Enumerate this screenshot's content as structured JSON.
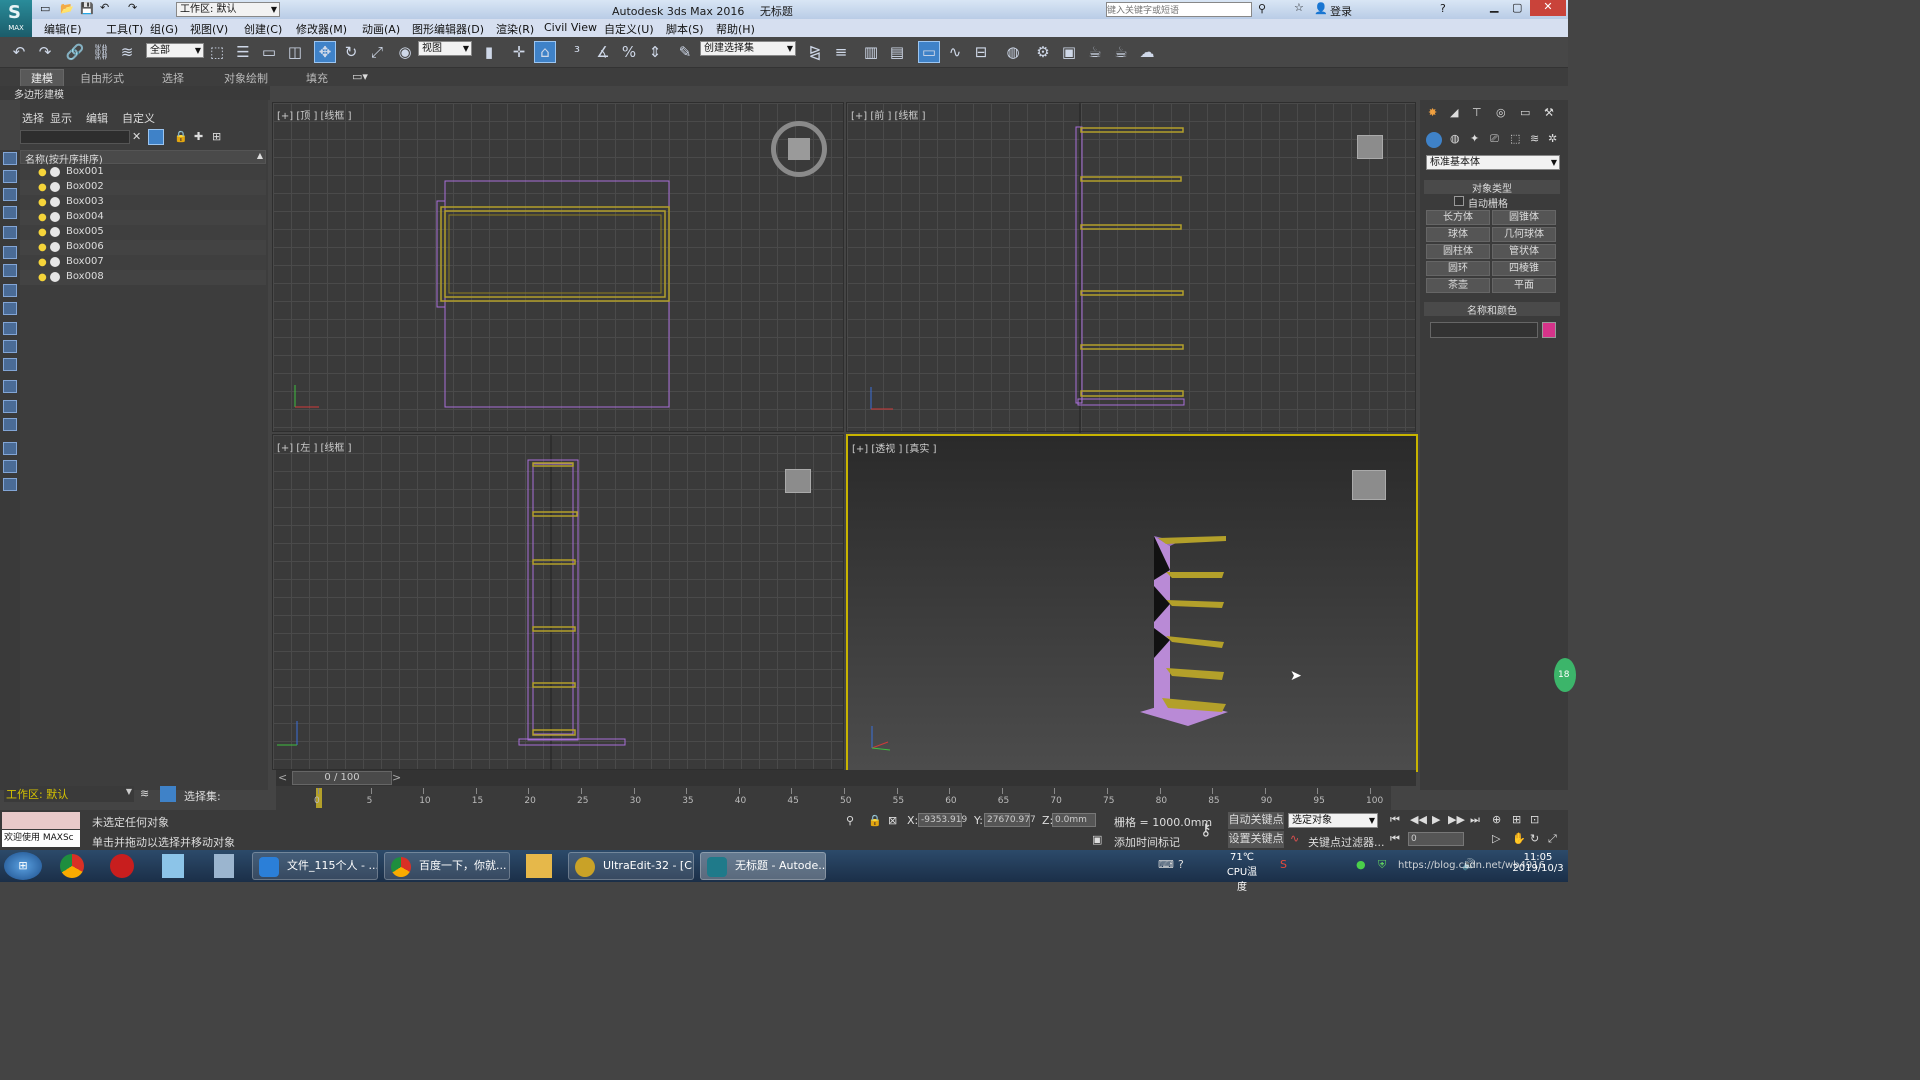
{
  "title_bar": {
    "workspace_label": "工作区: 默认",
    "app_title": "Autodesk 3ds Max 2016",
    "doc_title": "无标题",
    "search_placeholder": "键入关键字或短语",
    "login_label": "登录",
    "logo_text": "MAX"
  },
  "menu": [
    "编辑(E)",
    "工具(T)",
    "组(G)",
    "视图(V)",
    "创建(C)",
    "修改器(M)",
    "动画(A)",
    "图形编辑器(D)",
    "渲染(R)",
    "Civil View",
    "自定义(U)",
    "脚本(S)",
    "帮助(H)"
  ],
  "toolbar": {
    "selection_filter": "全部",
    "ref_coord": "视图",
    "named_selection": "创建选择集"
  },
  "ribbon": {
    "tabs": [
      "建模",
      "自由形式",
      "选择",
      "对象绘制",
      "填充"
    ],
    "active_tab": "建模",
    "sub_label": "多边形建模"
  },
  "scene_explorer": {
    "menu": [
      "选择",
      "显示",
      "编辑",
      "自定义"
    ],
    "column_header": "名称(按升序排序)",
    "items": [
      "Box001",
      "Box002",
      "Box003",
      "Box004",
      "Box005",
      "Box006",
      "Box007",
      "Box008"
    ],
    "workspace": "工作区: 默认",
    "selection_set_label": "选择集:"
  },
  "viewports": {
    "top": "[+] [顶 ] [线框 ]",
    "front": "[+] [前 ] [线框 ]",
    "left": "[+] [左 ] [线框 ]",
    "perspective": "[+] [透视 ] [真实 ]"
  },
  "command_panel": {
    "category": "标准基本体",
    "rollout_object_type": "对象类型",
    "autogrid": "自动栅格",
    "buttons": [
      "长方体",
      "圆锥体",
      "球体",
      "几何球体",
      "圆柱体",
      "管状体",
      "圆环",
      "四棱锥",
      "茶壶",
      "平面"
    ],
    "rollout_name_color": "名称和颜色",
    "object_color": "#d6338a"
  },
  "timeline": {
    "frame_label": "0 / 100",
    "ticks": [
      "0",
      "5",
      "10",
      "15",
      "20",
      "25",
      "30",
      "35",
      "40",
      "45",
      "50",
      "55",
      "60",
      "65",
      "70",
      "75",
      "80",
      "85",
      "90",
      "95",
      "100"
    ]
  },
  "status": {
    "welcome": "欢迎使用 MAXSc",
    "selection_msg": "未选定任何对象",
    "prompt": "单击并拖动以选择并移动对象",
    "x_label": "X:",
    "x_value": "-9353.919",
    "y_label": "Y:",
    "y_value": "27670.977",
    "z_label": "Z:",
    "z_value": "0.0mm",
    "grid": "栅格 = 1000.0mm",
    "auto_key": "自动关键点",
    "set_key": "设置关键点",
    "key_mode": "选定对象",
    "key_filters": "关键点过滤器...",
    "add_time_tag": "添加时间标记",
    "frame_value": "0"
  },
  "taskbar": {
    "tasks": [
      "文件_115个人 - ...",
      "百度一下，你就...",
      "UltraEdit-32 - [C...",
      "无标题 - Autode..."
    ],
    "temp": "71℃",
    "temp_label": "CPU温度",
    "time": "11:05",
    "date": "2019/10/3",
    "watermark": "https://blog.csdn.net/wb4916"
  },
  "colors": {
    "accent": "#3f82c8",
    "shelf_purple": "#b98ad6",
    "shelf_gold": "#b3a02a",
    "active_viewport": "#c8b400"
  }
}
